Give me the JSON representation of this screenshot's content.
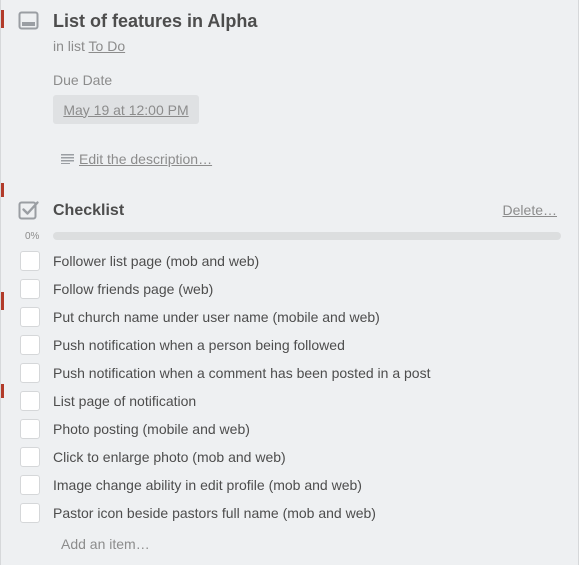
{
  "card": {
    "title": "List of features in Alpha",
    "in_list_prefix": "in list",
    "list_name": "To Do"
  },
  "due": {
    "label": "Due Date",
    "value": "May 19 at 12:00 PM"
  },
  "description": {
    "link": "Edit the description…"
  },
  "checklist": {
    "title": "Checklist",
    "delete_label": "Delete…",
    "progress_label": "0%",
    "progress_fraction": 0,
    "progress_color": "#61bd4f",
    "items": [
      {
        "label": "Follower list page (mob and web)",
        "checked": false
      },
      {
        "label": "Follow friends page (web)",
        "checked": false
      },
      {
        "label": "Put church name under user name (mobile and web)",
        "checked": false
      },
      {
        "label": "Push notification when a person being followed",
        "checked": false
      },
      {
        "label": "Push notification when a comment has been posted in a post",
        "checked": false
      },
      {
        "label": "List page of notification",
        "checked": false
      },
      {
        "label": "Photo posting (mobile and web)",
        "checked": false
      },
      {
        "label": "Click to enlarge photo (mob and web)",
        "checked": false
      },
      {
        "label": "Image change ability in edit profile (mob and web)",
        "checked": false
      },
      {
        "label": "Pastor icon beside pastors full name (mob and web)",
        "checked": false
      }
    ],
    "add_item_label": "Add an item…"
  },
  "icons": {
    "header": "card-icon",
    "description": "description-lines-icon",
    "checklist": "checklist-icon"
  }
}
